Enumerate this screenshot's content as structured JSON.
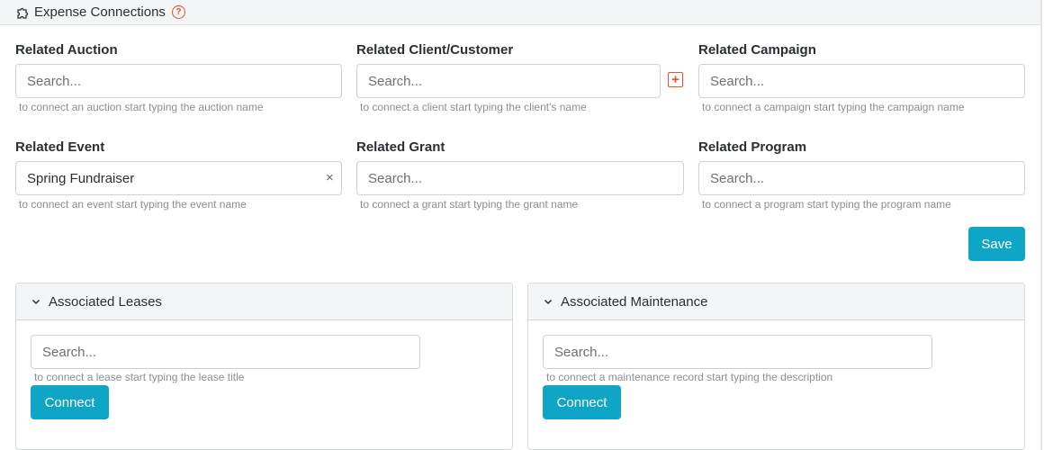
{
  "header": {
    "title": "Expense Connections",
    "help": "?"
  },
  "fields": {
    "auction": {
      "label": "Related Auction",
      "value": "",
      "placeholder": "Search...",
      "help": "to connect an auction start typing the auction name"
    },
    "client": {
      "label": "Related Client/Customer",
      "value": "",
      "placeholder": "Search...",
      "help": "to connect a client start typing the client's name",
      "add": "+"
    },
    "campaign": {
      "label": "Related Campaign",
      "value": "",
      "placeholder": "Search...",
      "help": "to connect a campaign start typing the campaign name"
    },
    "event": {
      "label": "Related Event",
      "value": "Spring Fundraiser",
      "placeholder": "Search...",
      "help": "to connect an event start typing the event name",
      "clear": "×"
    },
    "grant": {
      "label": "Related Grant",
      "value": "",
      "placeholder": "Search...",
      "help": "to connect a grant start typing the grant name"
    },
    "program": {
      "label": "Related Program",
      "value": "",
      "placeholder": "Search...",
      "help": "to connect a program start typing the program name"
    }
  },
  "save_label": "Save",
  "panels": {
    "leases": {
      "title": "Associated Leases",
      "placeholder": "Search...",
      "help": "to connect a lease start typing the lease title",
      "button": "Connect"
    },
    "maintenance": {
      "title": "Associated Maintenance",
      "placeholder": "Search...",
      "help": "to connect a maintenance record start typing the description",
      "button": "Connect"
    }
  },
  "colors": {
    "accent": "#0ea5c6",
    "warning": "#e0542f"
  }
}
